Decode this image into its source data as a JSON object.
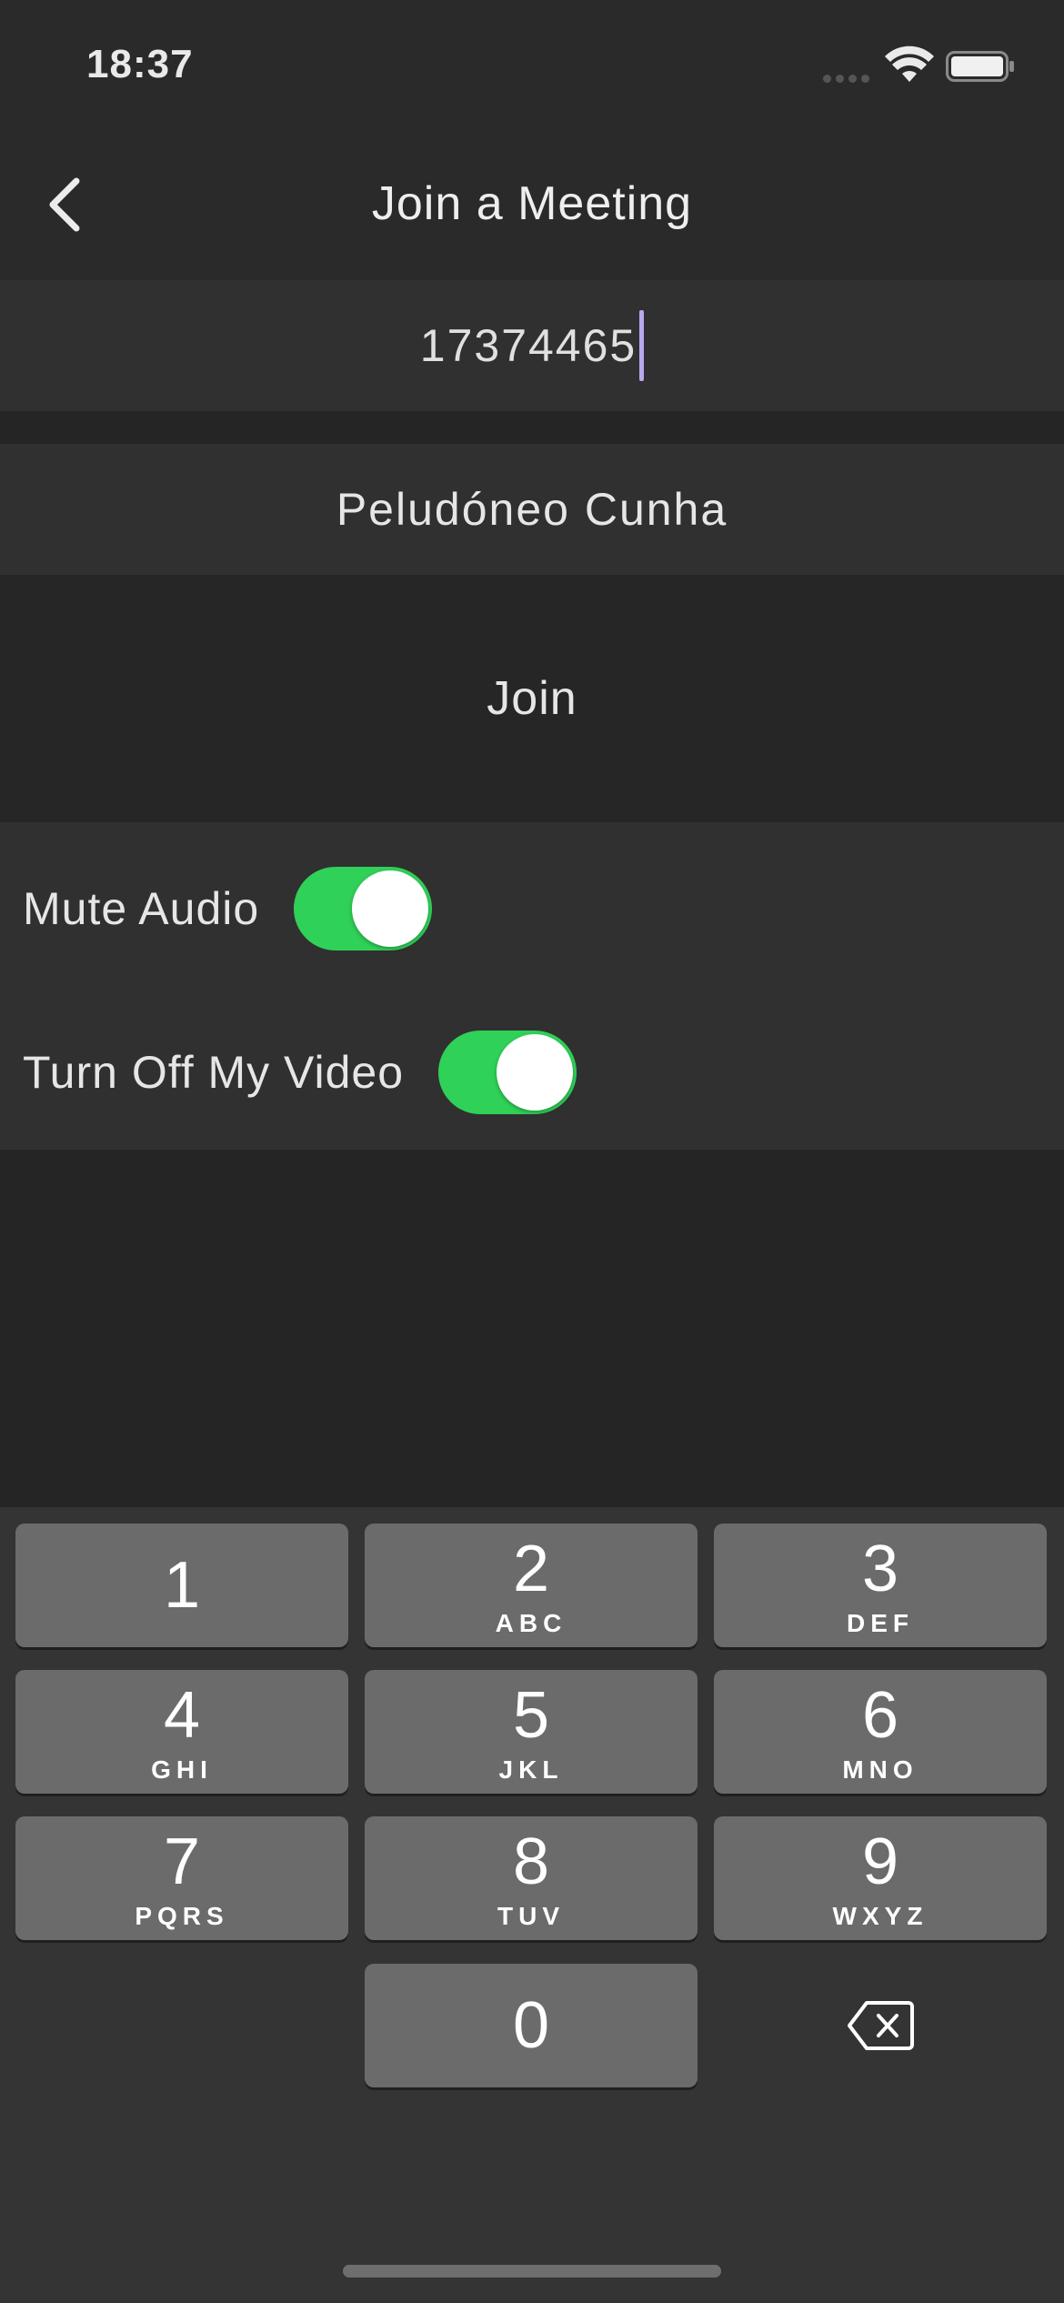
{
  "status_bar": {
    "time": "18:37"
  },
  "nav": {
    "title": "Join a Meeting",
    "back_icon": "chevron-left-icon"
  },
  "form": {
    "meeting_id": "17374465",
    "name": "Peludóneo Cunha"
  },
  "join": {
    "label": "Join"
  },
  "options": {
    "mute_audio": {
      "label": "Mute Audio",
      "on": true
    },
    "turn_off_video": {
      "label": "Turn Off My Video",
      "on": true
    }
  },
  "keypad": {
    "keys": [
      {
        "digit": "1",
        "letters": ""
      },
      {
        "digit": "2",
        "letters": "ABC"
      },
      {
        "digit": "3",
        "letters": "DEF"
      },
      {
        "digit": "4",
        "letters": "GHI"
      },
      {
        "digit": "5",
        "letters": "JKL"
      },
      {
        "digit": "6",
        "letters": "MNO"
      },
      {
        "digit": "7",
        "letters": "PQRS"
      },
      {
        "digit": "8",
        "letters": "TUV"
      },
      {
        "digit": "9",
        "letters": "WXYZ"
      },
      {
        "digit": "0",
        "letters": ""
      }
    ],
    "delete_icon": "backspace-icon"
  },
  "colors": {
    "toggle_on": "#30d158",
    "caret": "#b9a8ee",
    "key_bg": "#6b6b6b"
  }
}
